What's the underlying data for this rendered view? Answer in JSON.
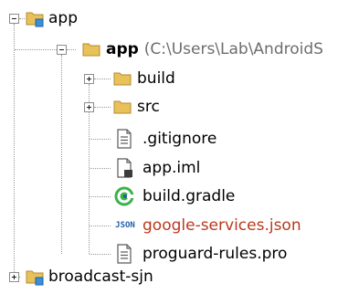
{
  "tree": {
    "root_module": {
      "label": "app",
      "icon": "module-folder-icon",
      "expanded": true
    },
    "app_folder": {
      "label": "app",
      "path": "(C:\\Users\\Lab\\AndroidS",
      "icon": "folder-icon",
      "expanded": true
    },
    "children": [
      {
        "label": "build",
        "icon": "folder-icon",
        "expandable": true,
        "expanded": false
      },
      {
        "label": "src",
        "icon": "folder-icon",
        "expandable": true,
        "expanded": false
      },
      {
        "label": ".gitignore",
        "icon": "text-file-icon",
        "expandable": false
      },
      {
        "label": "app.iml",
        "icon": "iml-file-icon",
        "expandable": false
      },
      {
        "label": "build.gradle",
        "icon": "gradle-icon",
        "expandable": false
      },
      {
        "label": "google-services.json",
        "icon": "json-file-icon",
        "expandable": false,
        "color": "#b83a1e"
      },
      {
        "label": "proguard-rules.pro",
        "icon": "text-file-icon",
        "expandable": false
      }
    ],
    "second_module": {
      "label": "broadcast-sjn",
      "icon": "module-folder-icon",
      "expanded": false
    }
  },
  "colors": {
    "folder": "#e8c15a",
    "module_badge": "#3a8fd6",
    "gradle": "#3bb34a",
    "json_badge": "#1f5fa8",
    "untracked_text": "#b83a1e"
  }
}
